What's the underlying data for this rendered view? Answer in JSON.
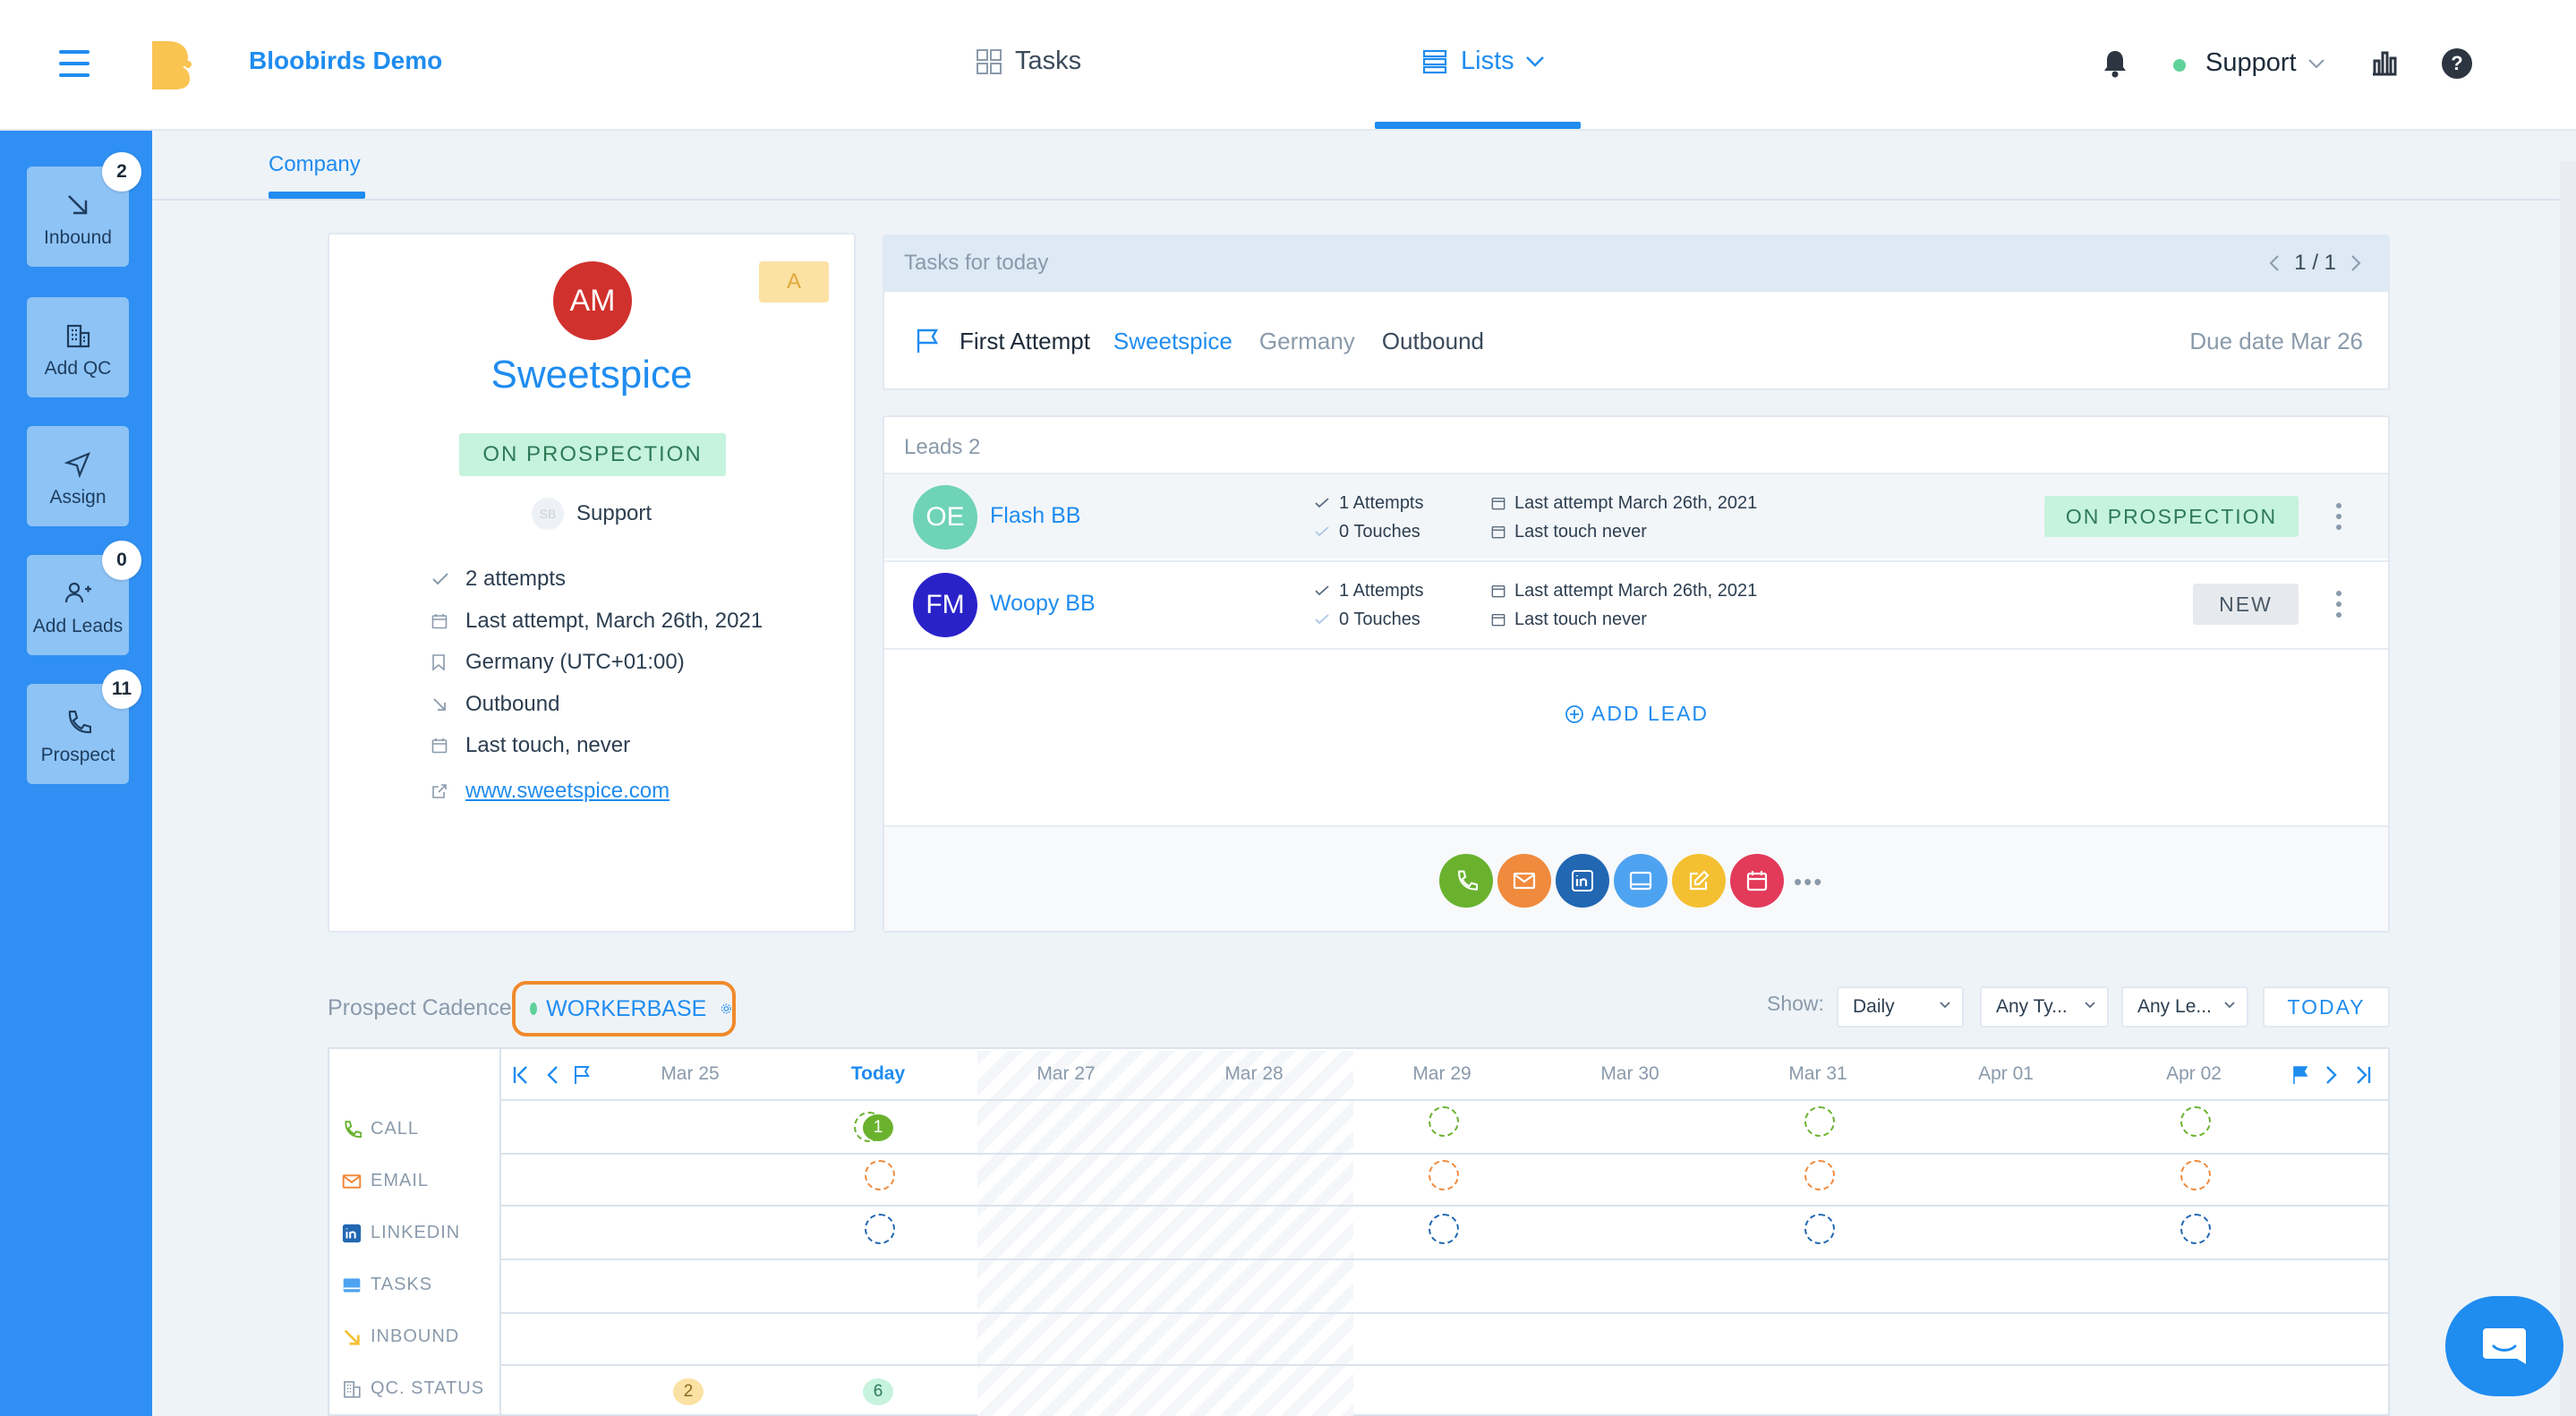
{
  "header": {
    "brand": "Bloobirds Demo",
    "nav_tasks": "Tasks",
    "nav_lists": "Lists",
    "user": "Support",
    "status_color": "#5fd29a"
  },
  "sidebar": {
    "items": [
      {
        "label": "Inbound",
        "badge": "2",
        "icon": "arrow-down-right-icon"
      },
      {
        "label": "Add QC",
        "badge": "",
        "icon": "building-icon"
      },
      {
        "label": "Assign",
        "badge": "",
        "icon": "send-icon"
      },
      {
        "label": "Add Leads",
        "badge": "0",
        "icon": "add-user-icon"
      },
      {
        "label": "Prospect",
        "badge": "11",
        "icon": "phone-icon"
      }
    ]
  },
  "tabs": {
    "company": "Company"
  },
  "company": {
    "initials": "AM",
    "grade": "A",
    "name": "Sweetspice",
    "status": "ON PROSPECTION",
    "owner_initials": "SB",
    "owner": "Support",
    "attempts": "2 attempts",
    "last_attempt": "Last attempt, March 26th, 2021",
    "country": "Germany (UTC+01:00)",
    "source": "Outbound",
    "last_touch": "Last touch, never",
    "website": "www.sweetspice.com"
  },
  "tasks": {
    "title": "Tasks for today",
    "pager": "1 / 1",
    "task": {
      "name": "First Attempt",
      "company": "Sweetspice",
      "country": "Germany",
      "type": "Outbound",
      "due": "Due date Mar 26"
    }
  },
  "leads": {
    "title": "Leads 2",
    "items": [
      {
        "initials": "OE",
        "name": "Flash BB",
        "attempts": "1 Attempts",
        "touches": "0 Touches",
        "last_attempt": "Last attempt March 26th, 2021",
        "last_touch": "Last touch never",
        "status": "ON PROSPECTION",
        "avatar_color": "#6fd3b8"
      },
      {
        "initials": "FM",
        "name": "Woopy BB",
        "attempts": "1 Attempts",
        "touches": "0 Touches",
        "last_attempt": "Last attempt March 26th, 2021",
        "last_touch": "Last touch never",
        "status": "NEW",
        "avatar_color": "#2a22c9"
      }
    ],
    "add_label": "ADD LEAD",
    "more": "•••"
  },
  "cadence": {
    "label": "Prospect Cadence",
    "name": "WORKERBASE",
    "show_label": "Show:",
    "filters": [
      "Daily",
      "Any Ty...",
      "Any Le..."
    ],
    "today_button": "TODAY",
    "columns": [
      "Mar 25",
      "Today",
      "Mar 27",
      "Mar 28",
      "Mar 29",
      "Mar 30",
      "Mar 31",
      "Apr 01",
      "Apr 02"
    ],
    "rows": [
      "CALL",
      "EMAIL",
      "LINKEDIN",
      "TASKS",
      "INBOUND",
      "QC. STATUS"
    ],
    "call_today_count": "1",
    "qc_counts": [
      "2",
      "6"
    ]
  }
}
